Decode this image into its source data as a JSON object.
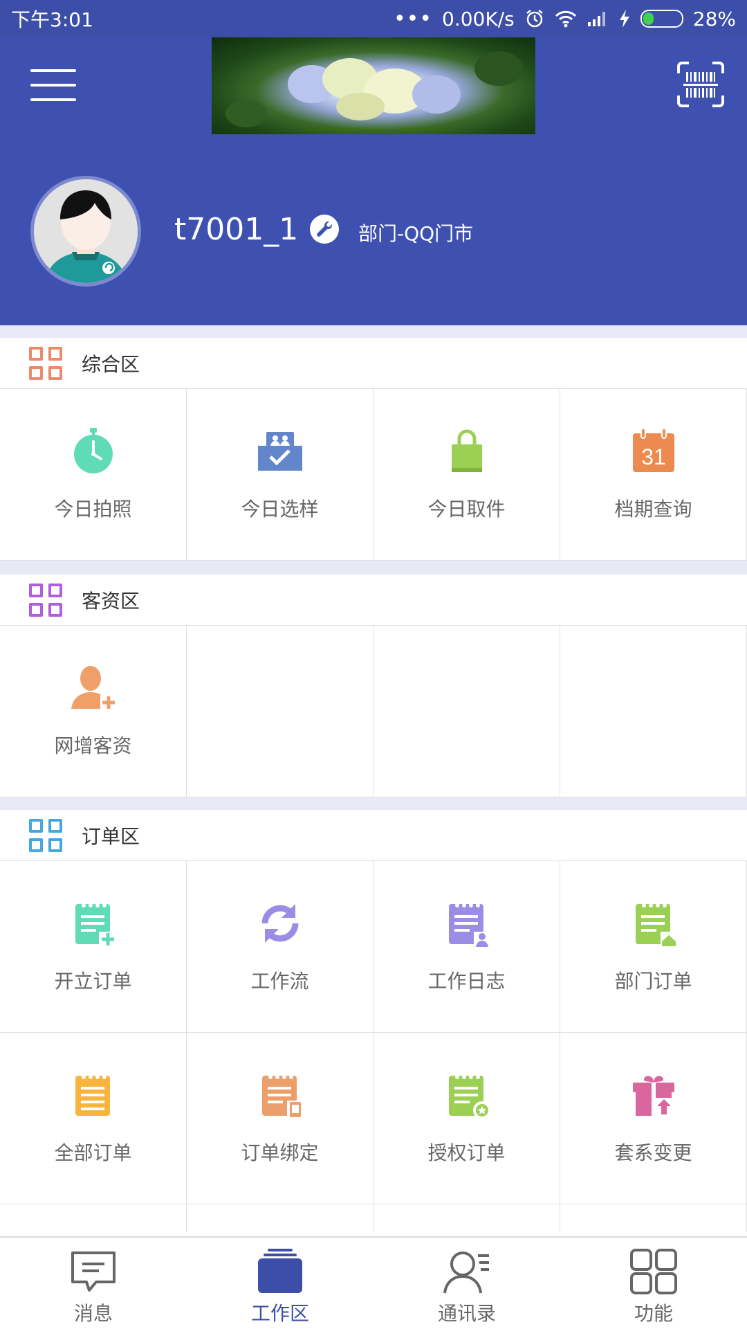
{
  "status_bar": {
    "time": "下午3:01",
    "net_speed": "0.00K/s",
    "battery": "28%",
    "battery_level": 0.28
  },
  "profile": {
    "username": "t7001_1",
    "department": "部门-QQ门市"
  },
  "sections": [
    {
      "title": "综合区",
      "icon": "grid-icon",
      "icon_color": "#ec8a69",
      "items": [
        {
          "label": "今日拍照",
          "icon": "stopwatch-icon",
          "color": "#5fdcb5"
        },
        {
          "label": "今日选样",
          "icon": "photo-select-icon",
          "color": "#6286c9"
        },
        {
          "label": "今日取件",
          "icon": "bag-icon",
          "color": "#9cd055"
        },
        {
          "label": "档期查询",
          "icon": "calendar-icon",
          "color": "#ec8a50",
          "icon_text": "31"
        }
      ]
    },
    {
      "title": "客资区",
      "icon": "grid-icon",
      "icon_color": "#b05ee0",
      "items": [
        {
          "label": "网增客资",
          "icon": "add-user-icon",
          "color": "#efa06a"
        }
      ]
    },
    {
      "title": "订单区",
      "icon": "grid-icon",
      "icon_color": "#44a7e2",
      "items": [
        {
          "label": "开立订单",
          "icon": "new-order-icon",
          "color": "#5fdcb5"
        },
        {
          "label": "工作流",
          "icon": "workflow-icon",
          "color": "#9b8ce6"
        },
        {
          "label": "工作日志",
          "icon": "work-log-icon",
          "color": "#9b8ce6"
        },
        {
          "label": "部门订单",
          "icon": "dept-order-icon",
          "color": "#9cd055"
        },
        {
          "label": "全部订单",
          "icon": "all-orders-icon",
          "color": "#f9b43e"
        },
        {
          "label": "订单绑定",
          "icon": "order-bind-icon",
          "color": "#ec9f6a"
        },
        {
          "label": "授权订单",
          "icon": "auth-order-icon",
          "color": "#9cd055"
        },
        {
          "label": "套系变更",
          "icon": "package-change-icon",
          "color": "#d9679d"
        }
      ]
    }
  ],
  "bottom_nav": [
    {
      "label": "消息",
      "icon": "message-icon",
      "active": false
    },
    {
      "label": "工作区",
      "icon": "workspace-icon",
      "active": true
    },
    {
      "label": "通讯录",
      "icon": "contacts-icon",
      "active": false
    },
    {
      "label": "功能",
      "icon": "function-grid-icon",
      "active": false
    }
  ],
  "colors": {
    "primary": "#3e51b1",
    "active_tab": "#3c4ea7"
  }
}
